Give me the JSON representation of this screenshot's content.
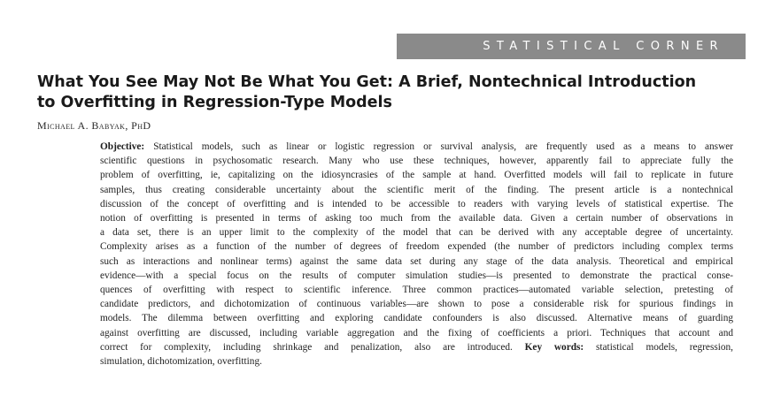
{
  "banner": {
    "label": "STATISTICAL CORNER"
  },
  "title": {
    "lines": [
      "What You See May Not Be What You Get: A Brief, Nontechnical Introduction",
      "to Overfitting in Regression-Type Models"
    ]
  },
  "author": {
    "name": "Michael A. Babyak, PhD"
  },
  "abstract": {
    "objective_label": "Objective:",
    "keywords_label": "Key words:",
    "lines": [
      "Statistical models, such as linear or logistic regression or survival analysis, are frequently used as a means to answer",
      "scientific questions in psychosomatic research. Many who use these techniques, however, apparently fail to appreciate fully the",
      "problem of overfitting, ie, capitalizing on the idiosyncrasies of the sample at hand. Overfitted models will fail to replicate in future",
      "samples, thus creating considerable uncertainty about the scientific merit of the finding. The present article is a nontechnical",
      "discussion of the concept of overfitting and is intended to be accessible to readers with varying levels of statistical expertise. The",
      "notion of overfitting is presented in terms of asking too much from the available data. Given a certain number of observations in",
      "a data set, there is an upper limit to the complexity of the model that can be derived with any acceptable degree of uncertainty.",
      "Complexity arises as a function of the number of degrees of freedom expended (the number of predictors including complex terms",
      "such as interactions and nonlinear terms) against the same data set during any stage of the data analysis. Theoretical and empirical",
      "evidence—with a special focus on the results of computer simulation studies—is presented to demonstrate the practical conse-",
      "quences of overfitting with respect to scientific inference. Three common practices—automated variable selection, pretesting of",
      "candidate predictors, and dichotomization of continuous variables—are shown to pose a considerable risk for spurious findings in",
      "models. The dilemma between overfitting and exploring candidate confounders is also discussed. Alternative means of guarding",
      "against overfitting are discussed, including variable aggregation and the fixing of coefficients a priori. Techniques that account and",
      "correct for complexity, including shrinkage and penalization, also are introduced.",
      "statistical models, regression,",
      "simulation, dichotomization, overfitting."
    ]
  }
}
